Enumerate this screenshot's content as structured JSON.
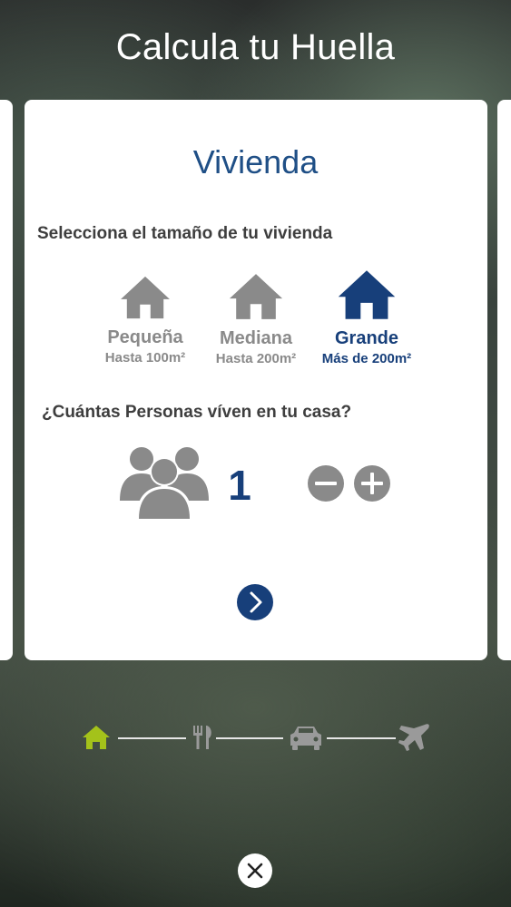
{
  "header": {
    "title": "Calcula tu Huella"
  },
  "card": {
    "title": "Vivienda",
    "size_question": "Selecciona el tamaño de tu vivienda",
    "sizes": [
      {
        "name": "Pequeña",
        "detail": "Hasta 100m²",
        "selected": false
      },
      {
        "name": "Mediana",
        "detail": "Hasta 200m²",
        "selected": false
      },
      {
        "name": "Grande",
        "detail": "Más de 200m²",
        "selected": true
      }
    ],
    "people_question": "¿Cuántas Personas víven en tu casa?",
    "people_count": "1"
  },
  "progress": {
    "steps": [
      {
        "icon": "home-icon",
        "active": true
      },
      {
        "icon": "utensils-icon",
        "active": false
      },
      {
        "icon": "car-icon",
        "active": false
      },
      {
        "icon": "airplane-icon",
        "active": false
      }
    ]
  },
  "colors": {
    "accent_blue": "#173f7a",
    "inactive_gray": "#8a8a8a",
    "active_green": "#a4c21a"
  }
}
